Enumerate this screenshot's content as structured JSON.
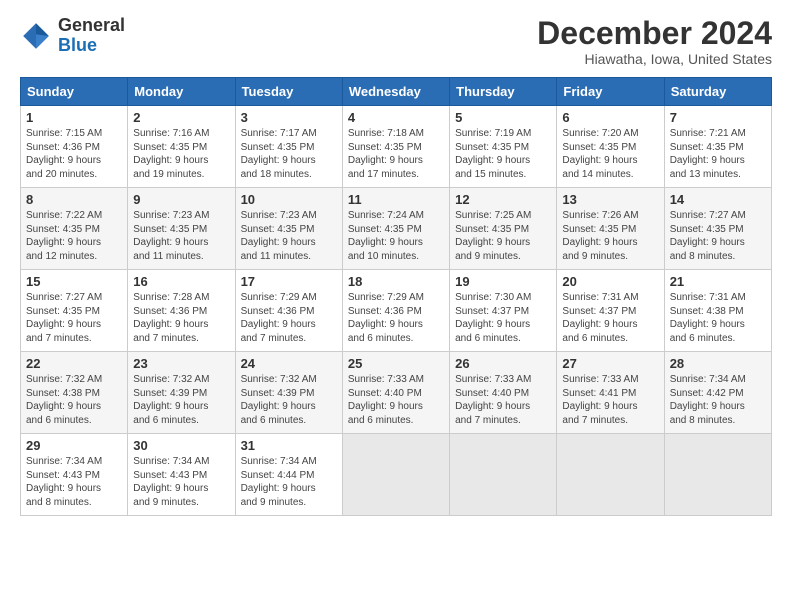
{
  "logo": {
    "general": "General",
    "blue": "Blue"
  },
  "header": {
    "month": "December 2024",
    "location": "Hiawatha, Iowa, United States"
  },
  "weekdays": [
    "Sunday",
    "Monday",
    "Tuesday",
    "Wednesday",
    "Thursday",
    "Friday",
    "Saturday"
  ],
  "weeks": [
    [
      {
        "day": "1",
        "info": "Sunrise: 7:15 AM\nSunset: 4:36 PM\nDaylight: 9 hours\nand 20 minutes."
      },
      {
        "day": "2",
        "info": "Sunrise: 7:16 AM\nSunset: 4:35 PM\nDaylight: 9 hours\nand 19 minutes."
      },
      {
        "day": "3",
        "info": "Sunrise: 7:17 AM\nSunset: 4:35 PM\nDaylight: 9 hours\nand 18 minutes."
      },
      {
        "day": "4",
        "info": "Sunrise: 7:18 AM\nSunset: 4:35 PM\nDaylight: 9 hours\nand 17 minutes."
      },
      {
        "day": "5",
        "info": "Sunrise: 7:19 AM\nSunset: 4:35 PM\nDaylight: 9 hours\nand 15 minutes."
      },
      {
        "day": "6",
        "info": "Sunrise: 7:20 AM\nSunset: 4:35 PM\nDaylight: 9 hours\nand 14 minutes."
      },
      {
        "day": "7",
        "info": "Sunrise: 7:21 AM\nSunset: 4:35 PM\nDaylight: 9 hours\nand 13 minutes."
      }
    ],
    [
      {
        "day": "8",
        "info": "Sunrise: 7:22 AM\nSunset: 4:35 PM\nDaylight: 9 hours\nand 12 minutes."
      },
      {
        "day": "9",
        "info": "Sunrise: 7:23 AM\nSunset: 4:35 PM\nDaylight: 9 hours\nand 11 minutes."
      },
      {
        "day": "10",
        "info": "Sunrise: 7:23 AM\nSunset: 4:35 PM\nDaylight: 9 hours\nand 11 minutes."
      },
      {
        "day": "11",
        "info": "Sunrise: 7:24 AM\nSunset: 4:35 PM\nDaylight: 9 hours\nand 10 minutes."
      },
      {
        "day": "12",
        "info": "Sunrise: 7:25 AM\nSunset: 4:35 PM\nDaylight: 9 hours\nand 9 minutes."
      },
      {
        "day": "13",
        "info": "Sunrise: 7:26 AM\nSunset: 4:35 PM\nDaylight: 9 hours\nand 9 minutes."
      },
      {
        "day": "14",
        "info": "Sunrise: 7:27 AM\nSunset: 4:35 PM\nDaylight: 9 hours\nand 8 minutes."
      }
    ],
    [
      {
        "day": "15",
        "info": "Sunrise: 7:27 AM\nSunset: 4:35 PM\nDaylight: 9 hours\nand 7 minutes."
      },
      {
        "day": "16",
        "info": "Sunrise: 7:28 AM\nSunset: 4:36 PM\nDaylight: 9 hours\nand 7 minutes."
      },
      {
        "day": "17",
        "info": "Sunrise: 7:29 AM\nSunset: 4:36 PM\nDaylight: 9 hours\nand 7 minutes."
      },
      {
        "day": "18",
        "info": "Sunrise: 7:29 AM\nSunset: 4:36 PM\nDaylight: 9 hours\nand 6 minutes."
      },
      {
        "day": "19",
        "info": "Sunrise: 7:30 AM\nSunset: 4:37 PM\nDaylight: 9 hours\nand 6 minutes."
      },
      {
        "day": "20",
        "info": "Sunrise: 7:31 AM\nSunset: 4:37 PM\nDaylight: 9 hours\nand 6 minutes."
      },
      {
        "day": "21",
        "info": "Sunrise: 7:31 AM\nSunset: 4:38 PM\nDaylight: 9 hours\nand 6 minutes."
      }
    ],
    [
      {
        "day": "22",
        "info": "Sunrise: 7:32 AM\nSunset: 4:38 PM\nDaylight: 9 hours\nand 6 minutes."
      },
      {
        "day": "23",
        "info": "Sunrise: 7:32 AM\nSunset: 4:39 PM\nDaylight: 9 hours\nand 6 minutes."
      },
      {
        "day": "24",
        "info": "Sunrise: 7:32 AM\nSunset: 4:39 PM\nDaylight: 9 hours\nand 6 minutes."
      },
      {
        "day": "25",
        "info": "Sunrise: 7:33 AM\nSunset: 4:40 PM\nDaylight: 9 hours\nand 6 minutes."
      },
      {
        "day": "26",
        "info": "Sunrise: 7:33 AM\nSunset: 4:40 PM\nDaylight: 9 hours\nand 7 minutes."
      },
      {
        "day": "27",
        "info": "Sunrise: 7:33 AM\nSunset: 4:41 PM\nDaylight: 9 hours\nand 7 minutes."
      },
      {
        "day": "28",
        "info": "Sunrise: 7:34 AM\nSunset: 4:42 PM\nDaylight: 9 hours\nand 8 minutes."
      }
    ],
    [
      {
        "day": "29",
        "info": "Sunrise: 7:34 AM\nSunset: 4:43 PM\nDaylight: 9 hours\nand 8 minutes."
      },
      {
        "day": "30",
        "info": "Sunrise: 7:34 AM\nSunset: 4:43 PM\nDaylight: 9 hours\nand 9 minutes."
      },
      {
        "day": "31",
        "info": "Sunrise: 7:34 AM\nSunset: 4:44 PM\nDaylight: 9 hours\nand 9 minutes."
      },
      {
        "day": "",
        "info": ""
      },
      {
        "day": "",
        "info": ""
      },
      {
        "day": "",
        "info": ""
      },
      {
        "day": "",
        "info": ""
      }
    ]
  ]
}
